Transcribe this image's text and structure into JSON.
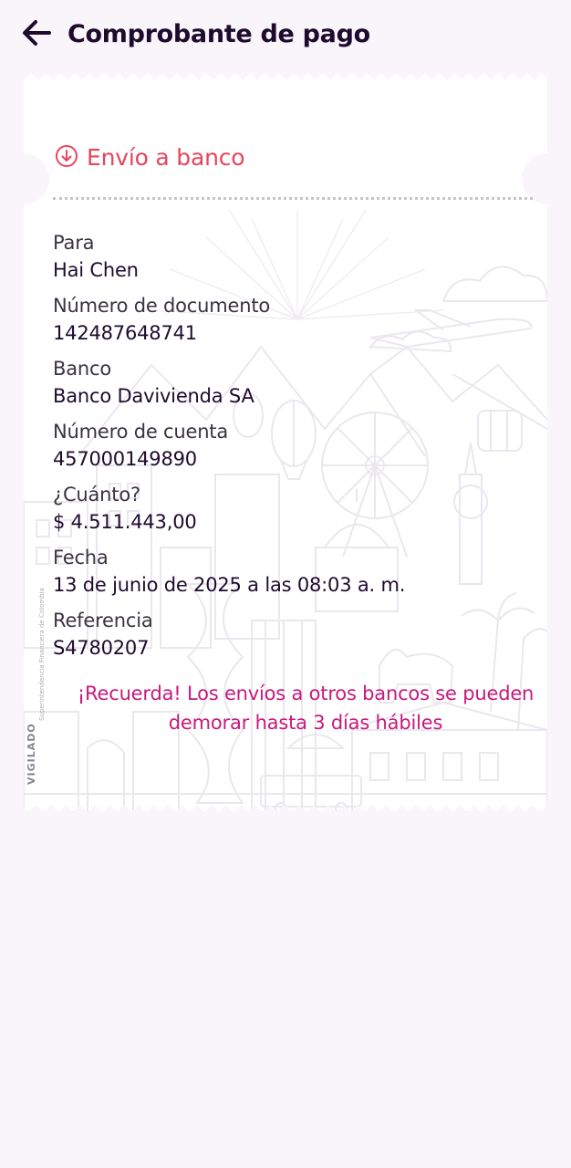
{
  "header": {
    "title": "Comprobante de pago"
  },
  "receipt": {
    "kind_label": "Envío a banco",
    "fields": [
      {
        "label": "Para",
        "value": "Hai Chen"
      },
      {
        "label": "Número de documento",
        "value": "142487648741"
      },
      {
        "label": "Banco",
        "value": "Banco Davivienda SA"
      },
      {
        "label": "Número de cuenta",
        "value": "457000149890"
      },
      {
        "label": "¿Cuánto?",
        "value": "$ 4.511.443,00"
      },
      {
        "label": "Fecha",
        "value": "13 de junio de 2025 a las 08:03 a. m."
      },
      {
        "label": "Referencia",
        "value": "S4780207"
      }
    ],
    "notice": "¡Recuerda! Los envíos a otros bancos se pueden demorar hasta 3 días hábiles"
  },
  "watermark": {
    "vigilado": "VIGILADO",
    "supervisor": "Superintendencia Financiera de Colombia"
  },
  "colors": {
    "background": "#faf5fa",
    "accent_red": "#e8455b",
    "accent_magenta": "#c8197d",
    "text_dark": "#1e0b2e"
  },
  "icons": {
    "back": "arrow-left-icon",
    "kind": "arrow-down-circle-icon"
  }
}
